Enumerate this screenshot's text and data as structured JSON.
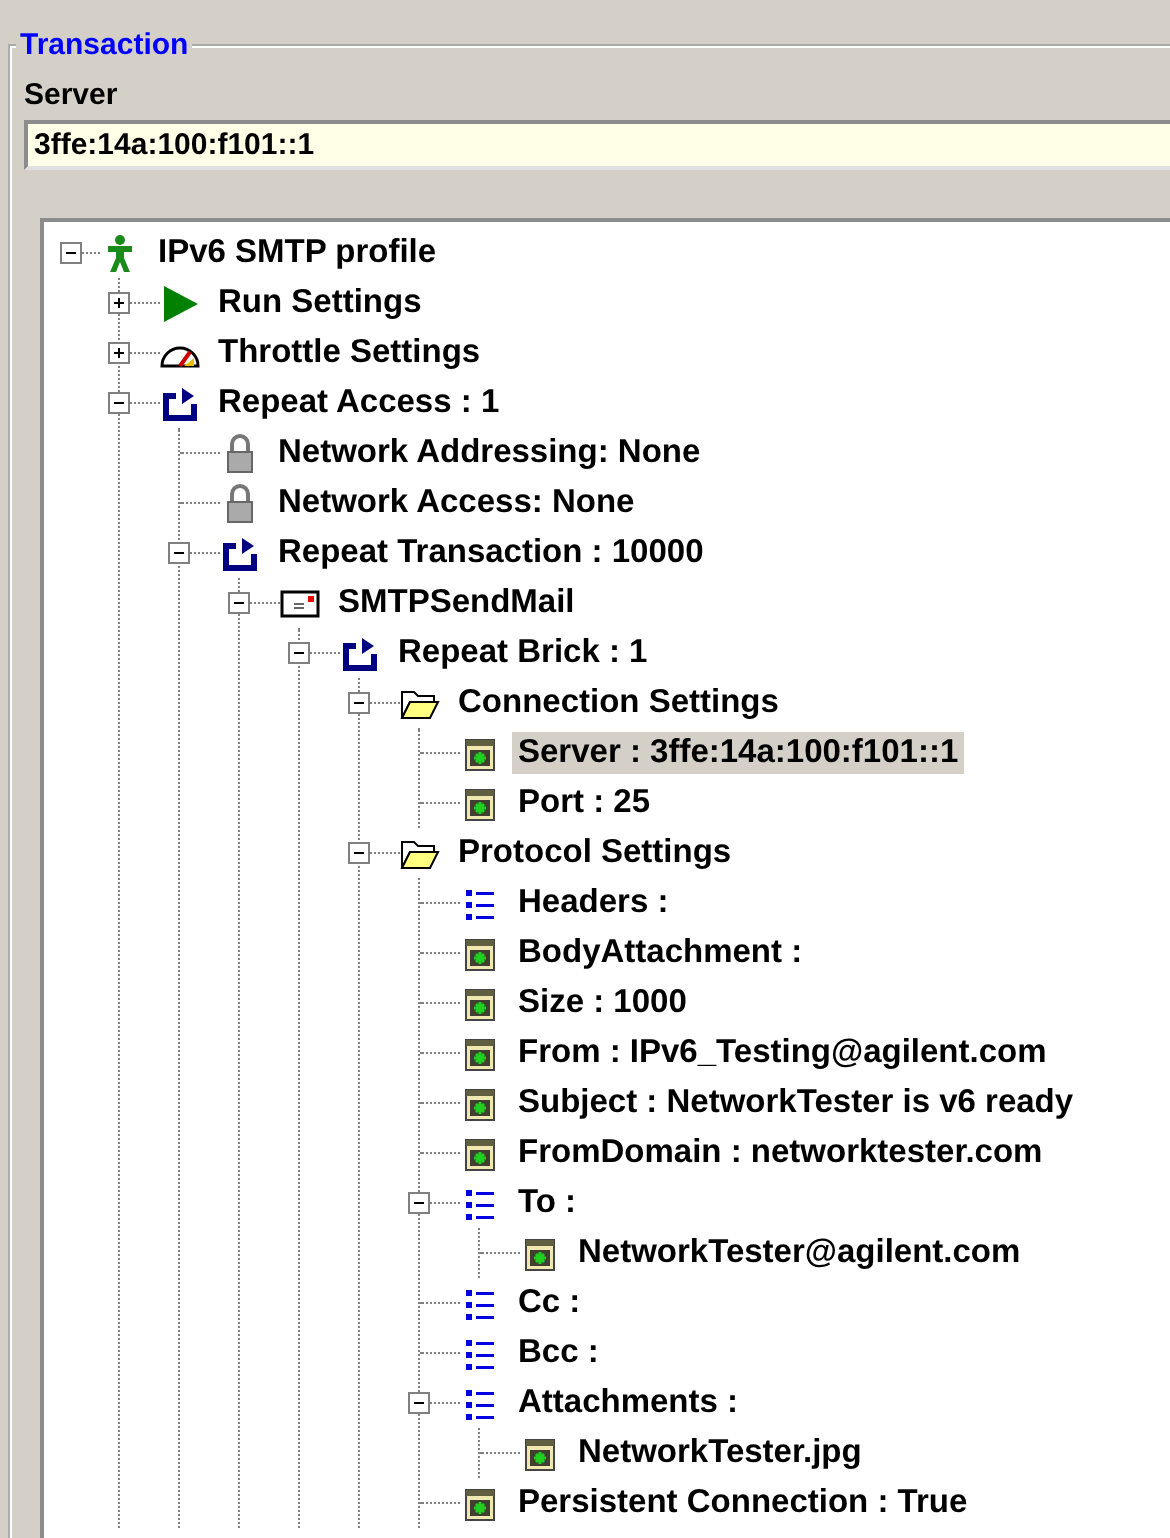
{
  "group": {
    "title": "Transaction"
  },
  "server": {
    "label": "Server",
    "value": "3ffe:14a:100:f101::1"
  },
  "tree": [
    {
      "label": "IPv6 SMTP profile",
      "kind": "figure",
      "expanded": true,
      "selected": false,
      "children": [
        {
          "label": "Run Settings",
          "kind": "play",
          "expanded": false,
          "selected": false
        },
        {
          "label": "Throttle Settings",
          "kind": "gauge",
          "expanded": false,
          "selected": false
        },
        {
          "label": "Repeat Access : 1",
          "kind": "repeat",
          "expanded": true,
          "selected": false,
          "children": [
            {
              "label": "Network Addressing: None",
              "kind": "lock",
              "selected": false
            },
            {
              "label": "Network Access: None",
              "kind": "lock",
              "selected": false
            },
            {
              "label": "Repeat Transaction : 10000",
              "kind": "repeat",
              "expanded": true,
              "selected": false,
              "children": [
                {
                  "label": "SMTPSendMail",
                  "kind": "mail",
                  "expanded": true,
                  "selected": false,
                  "children": [
                    {
                      "label": "Repeat Brick : 1",
                      "kind": "repeat",
                      "expanded": true,
                      "selected": false,
                      "children": [
                        {
                          "label": "Connection Settings",
                          "kind": "folder",
                          "expanded": true,
                          "selected": false,
                          "children": [
                            {
                              "label": "Server : 3ffe:14a:100:f101::1",
                              "kind": "field",
                              "selected": true
                            },
                            {
                              "label": "Port : 25",
                              "kind": "field",
                              "selected": false
                            }
                          ]
                        },
                        {
                          "label": "Protocol Settings",
                          "kind": "folder",
                          "expanded": true,
                          "selected": false,
                          "children": [
                            {
                              "label": "Headers :",
                              "kind": "list",
                              "selected": false
                            },
                            {
                              "label": "BodyAttachment :",
                              "kind": "field",
                              "selected": false
                            },
                            {
                              "label": "Size : 1000",
                              "kind": "field",
                              "selected": false
                            },
                            {
                              "label": "From : IPv6_Testing@agilent.com",
                              "kind": "field",
                              "selected": false
                            },
                            {
                              "label": "Subject : NetworkTester is v6 ready",
                              "kind": "field",
                              "selected": false
                            },
                            {
                              "label": "FromDomain : networktester.com",
                              "kind": "field",
                              "selected": false
                            },
                            {
                              "label": "To :",
                              "kind": "list",
                              "expanded": true,
                              "selected": false,
                              "children": [
                                {
                                  "label": "NetworkTester@agilent.com",
                                  "kind": "field",
                                  "selected": false
                                }
                              ]
                            },
                            {
                              "label": "Cc :",
                              "kind": "list",
                              "selected": false
                            },
                            {
                              "label": "Bcc :",
                              "kind": "list",
                              "selected": false
                            },
                            {
                              "label": "Attachments :",
                              "kind": "list",
                              "expanded": true,
                              "selected": false,
                              "children": [
                                {
                                  "label": "NetworkTester.jpg",
                                  "kind": "field",
                                  "selected": false
                                }
                              ]
                            },
                            {
                              "label": "Persistent Connection : True",
                              "kind": "field",
                              "selected": false
                            }
                          ]
                        }
                      ]
                    }
                  ]
                }
              ]
            }
          ]
        }
      ]
    }
  ]
}
